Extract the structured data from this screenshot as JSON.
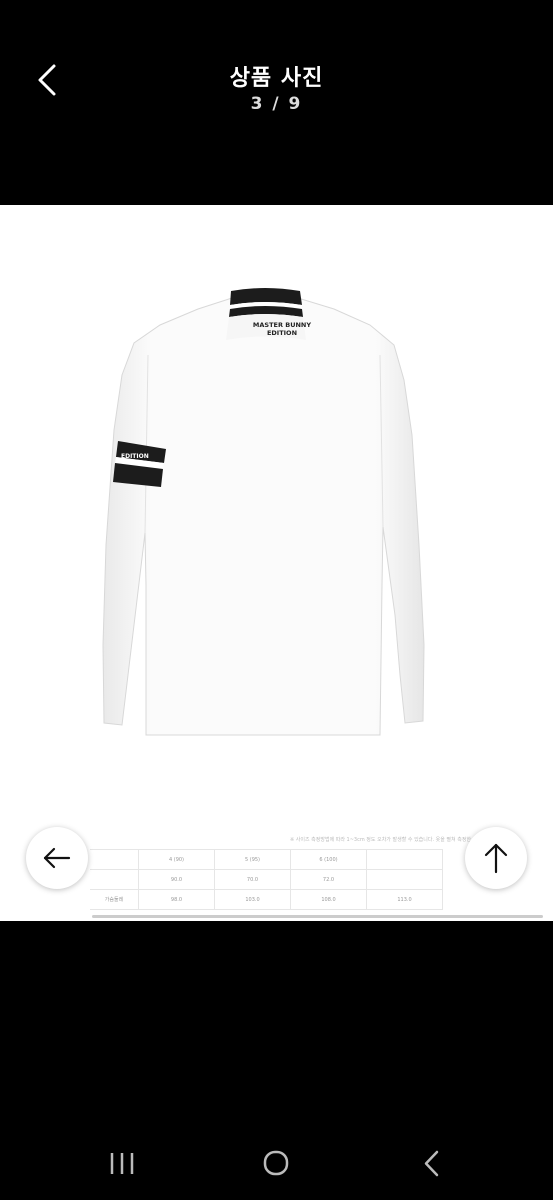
{
  "header": {
    "title": "상품 사진",
    "counter": "3 / 9"
  },
  "product": {
    "collar_text_line1": "MASTER BUNNY",
    "collar_text_line2": "EDITION",
    "sleeve_text": "EDITION"
  },
  "size_table": {
    "note": "※ 사이즈 측정방법에 따라 1~3cm 정도 오차가 발생할 수 있습니다. 옷을 펼쳐 측정한 사이즈입니다.",
    "headers": [
      "",
      "4 (90)",
      "5 (95)",
      "6 (100)",
      ""
    ],
    "rows": [
      [
        "",
        "90.0",
        "70.0",
        "72.0",
        ""
      ],
      [
        "가슴둘레",
        "98.0",
        "103.0",
        "108.0",
        "113.0"
      ]
    ]
  },
  "icons": {
    "back": "chevron-left-icon",
    "prev": "arrow-left-icon",
    "top": "arrow-up-icon",
    "recent_apps": "recent-apps-icon",
    "home": "home-icon",
    "system_back": "system-back-icon"
  }
}
